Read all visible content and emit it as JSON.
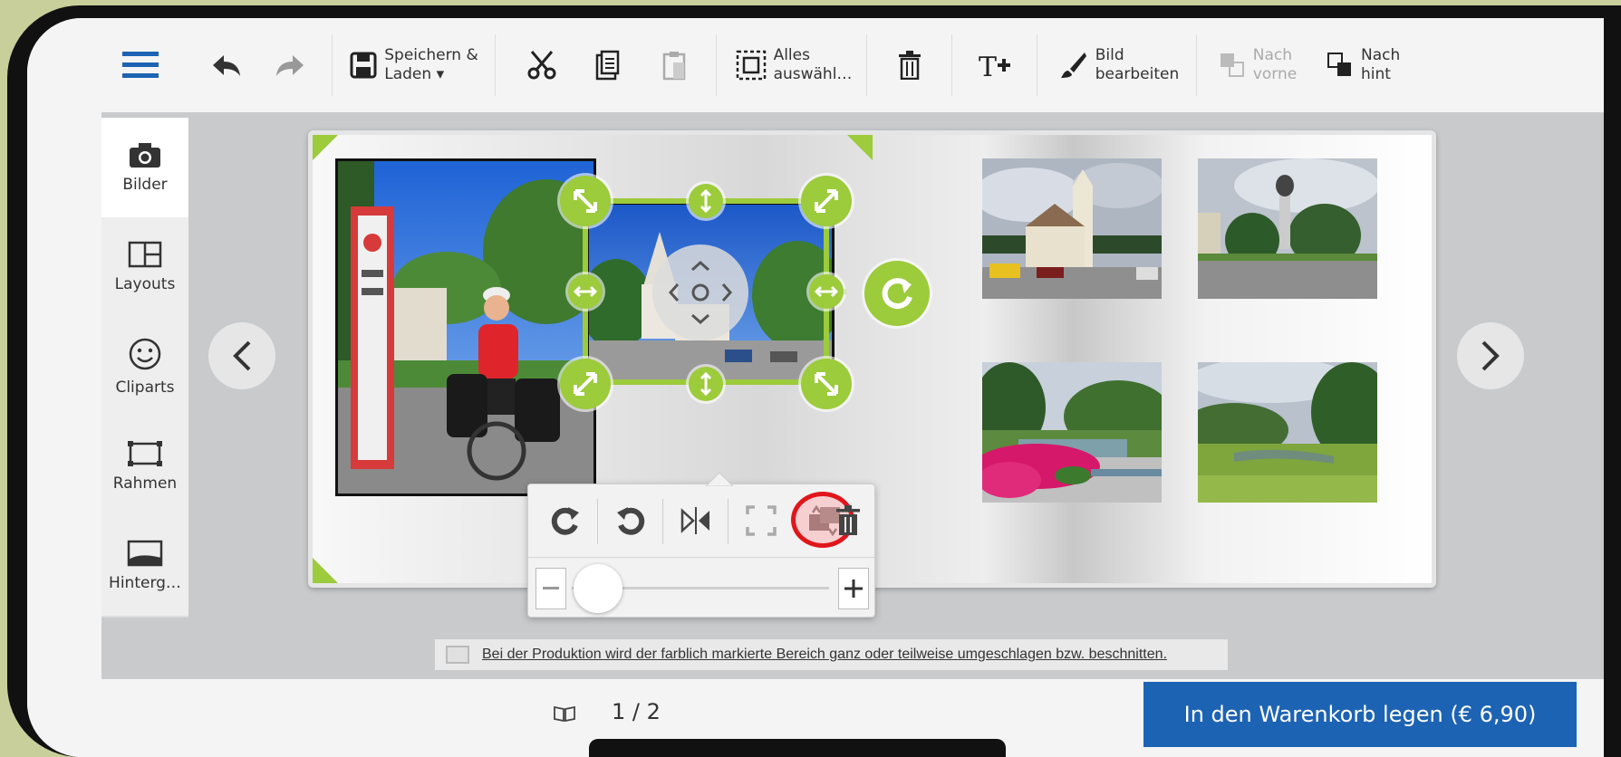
{
  "toolbar": {
    "save_load_line1": "Speichern &",
    "save_load_line2": "Laden ▾",
    "select_all_line1": "Alles",
    "select_all_line2": "auswähl…",
    "edit_image_line1": "Bild",
    "edit_image_line2": "bearbeiten",
    "to_front_line1": "Nach",
    "to_front_line2": "vorne",
    "to_back_line1": "Nach",
    "to_back_line2": "hint"
  },
  "sidebar": {
    "items": [
      {
        "label": "Bilder",
        "icon": "camera-icon"
      },
      {
        "label": "Layouts",
        "icon": "layout-icon"
      },
      {
        "label": "Cliparts",
        "icon": "smiley-icon"
      },
      {
        "label": "Rahmen",
        "icon": "frame-icon"
      },
      {
        "label": "Hinterg…",
        "icon": "background-icon"
      }
    ]
  },
  "notice": {
    "text": "Bei der Produktion wird der farblich markierte Bereich ganz oder teilweise umgeschlagen bzw. beschnitten."
  },
  "footer": {
    "page_indicator": "1 / 2",
    "cart_button": "In den Warenkorb legen (€ 6,90)"
  },
  "colors": {
    "accent_green": "#9ccb3b",
    "cart_blue": "#1d63b3",
    "highlight_red": "#e0161b"
  }
}
